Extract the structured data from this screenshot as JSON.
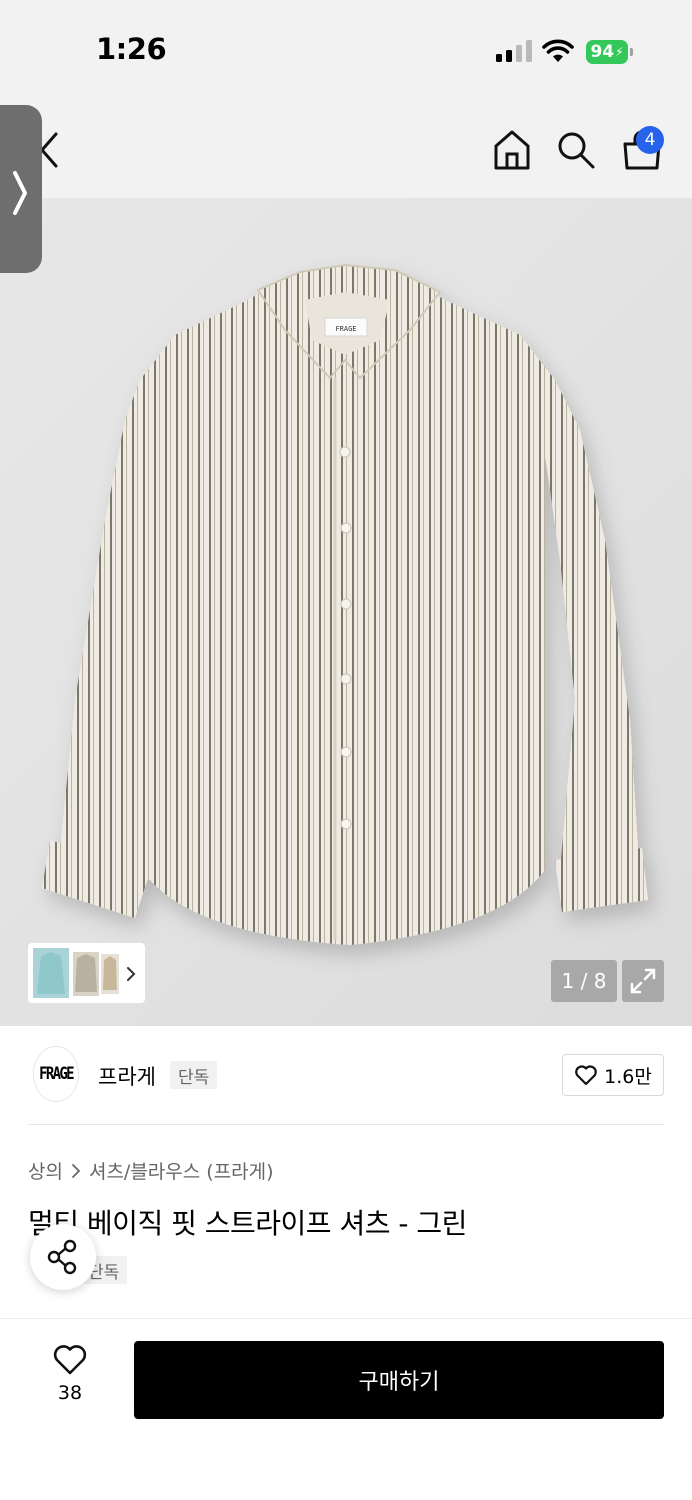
{
  "status_bar": {
    "time": "1:26",
    "battery": "94"
  },
  "header": {
    "cart_count": "4"
  },
  "gallery": {
    "counter": "1 / 8"
  },
  "brand": {
    "logo_text": "FRAGE",
    "name": "프라게",
    "tag": "단독",
    "likes": "1.6만"
  },
  "breadcrumb": {
    "level1": "상의",
    "level2": "셔츠/블라우스 (프라게)"
  },
  "product": {
    "title": "멀티 베이직 핏 스트라이프 셔츠 - 그린",
    "badge": "단독"
  },
  "bottom_bar": {
    "wish_count": "38",
    "buy_label": "구매하기"
  },
  "colors": {
    "accent_blue": "#2563eb",
    "battery_green": "#34c759",
    "buy_button": "#000000"
  }
}
